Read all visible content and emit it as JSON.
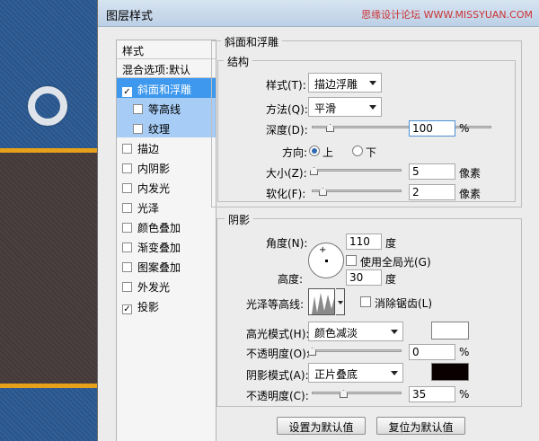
{
  "dialog": {
    "title": "图层样式",
    "watermark": "思缘设计论坛 WWW.MISSYUAN.COM"
  },
  "style_list": {
    "header": "样式",
    "blend_options": "混合选项:默认",
    "items": [
      {
        "label": "斜面和浮雕",
        "checked": true,
        "selected": true
      },
      {
        "label": "等高线",
        "checked": false,
        "sub": true
      },
      {
        "label": "纹理",
        "checked": false,
        "sub": true
      },
      {
        "label": "描边",
        "checked": false
      },
      {
        "label": "内阴影",
        "checked": false
      },
      {
        "label": "内发光",
        "checked": false
      },
      {
        "label": "光泽",
        "checked": false
      },
      {
        "label": "颜色叠加",
        "checked": false
      },
      {
        "label": "渐变叠加",
        "checked": false
      },
      {
        "label": "图案叠加",
        "checked": false
      },
      {
        "label": "外发光",
        "checked": false
      },
      {
        "label": "投影",
        "checked": true
      }
    ]
  },
  "bevel": {
    "section_title": "斜面和浮雕",
    "structure_title": "结构",
    "style_label": "样式(T):",
    "style_value": "描边浮雕",
    "technique_label": "方法(Q):",
    "technique_value": "平滑",
    "depth_label": "深度(D):",
    "depth_value": "100",
    "depth_unit": "%",
    "depth_fraction": 0.1,
    "direction_label": "方向:",
    "direction_up": "上",
    "direction_down": "下",
    "direction_selected": "上",
    "size_label": "大小(Z):",
    "size_value": "5",
    "size_unit": "像素",
    "size_fraction": 0.02,
    "soften_label": "软化(F):",
    "soften_value": "2",
    "soften_unit": "像素",
    "soften_fraction": 0.12
  },
  "shading": {
    "title": "阴影",
    "angle_label": "角度(N):",
    "angle_value": "110",
    "angle_unit": "度",
    "global_light_label": "使用全局光(G)",
    "altitude_label": "高度:",
    "altitude_value": "30",
    "altitude_unit": "度",
    "gloss_contour_label": "光泽等高线:",
    "anti_alias_label": "消除锯齿(L)",
    "highlight_mode_label": "高光模式(H):",
    "highlight_mode_value": "颜色减淡",
    "highlight_color": "#ffffff",
    "highlight_opacity_label": "不透明度(O):",
    "highlight_opacity_value": "0",
    "highlight_opacity_unit": "%",
    "highlight_opacity_fraction": 0.0,
    "shadow_mode_label": "阴影模式(A):",
    "shadow_mode_value": "正片叠底",
    "shadow_color": "#0a0000",
    "shadow_opacity_label": "不透明度(C):",
    "shadow_opacity_value": "35",
    "shadow_opacity_unit": "%",
    "shadow_opacity_fraction": 0.35
  },
  "buttons": {
    "make_default": "设置为默认值",
    "reset_default": "复位为默认值"
  }
}
